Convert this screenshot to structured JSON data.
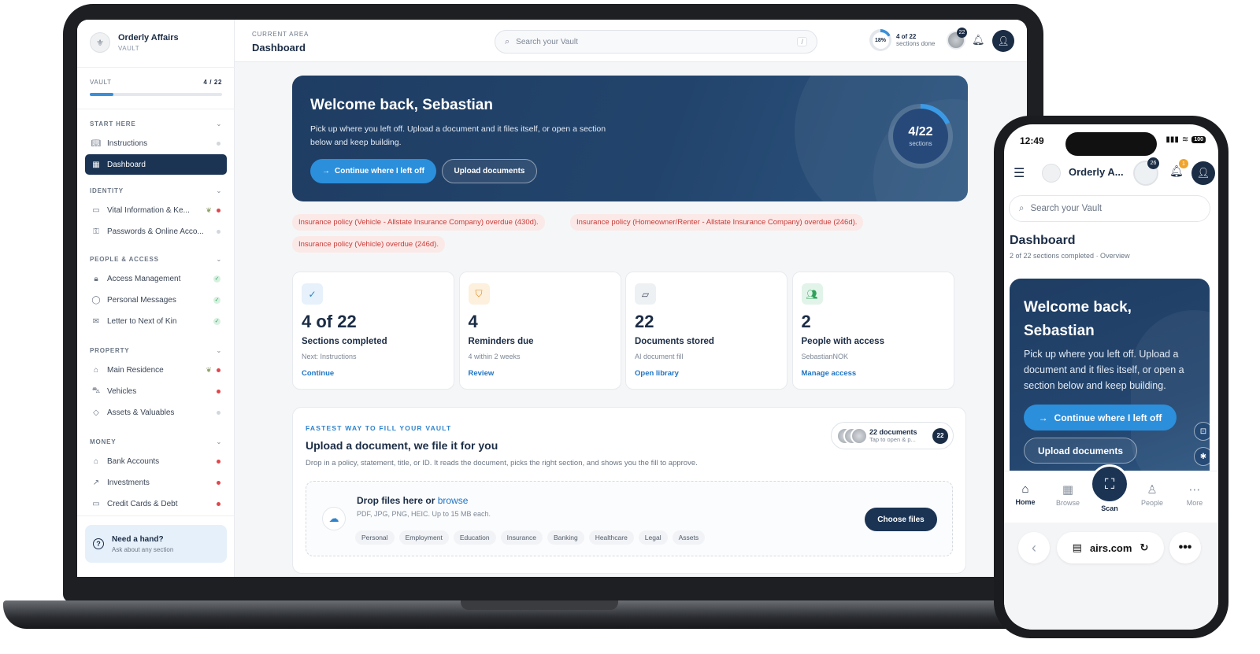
{
  "desktop": {
    "brand": {
      "name": "Orderly Affairs",
      "sub": "VAULT"
    },
    "vault": {
      "label": "VAULT",
      "count": "4 / 22",
      "progress": 0.18
    },
    "groups": [
      {
        "label": "START HERE",
        "items": [
          {
            "label": "Instructions",
            "icon": "book-icon",
            "status": "none"
          },
          {
            "label": "Dashboard",
            "icon": "grid-icon",
            "status": "active"
          }
        ]
      },
      {
        "label": "IDENTITY",
        "items": [
          {
            "label": "Vital Information & Ke...",
            "icon": "id-card-icon",
            "status": "required"
          },
          {
            "label": "Passwords & Online Acco...",
            "icon": "key-icon",
            "status": "none"
          }
        ]
      },
      {
        "label": "PEOPLE & ACCESS",
        "items": [
          {
            "label": "Access Management",
            "icon": "lock-icon",
            "status": "done"
          },
          {
            "label": "Personal Messages",
            "icon": "message-icon",
            "status": "done"
          },
          {
            "label": "Letter to Next of Kin",
            "icon": "mail-icon",
            "status": "done"
          }
        ]
      },
      {
        "label": "PROPERTY",
        "items": [
          {
            "label": "Main Residence",
            "icon": "home-icon",
            "status": "required"
          },
          {
            "label": "Vehicles",
            "icon": "car-icon",
            "status": "required"
          },
          {
            "label": "Assets & Valuables",
            "icon": "gem-icon",
            "status": "none"
          }
        ]
      },
      {
        "label": "MONEY",
        "items": [
          {
            "label": "Bank Accounts",
            "icon": "bank-icon",
            "status": "required"
          },
          {
            "label": "Investments",
            "icon": "trend-icon",
            "status": "required"
          },
          {
            "label": "Credit Cards & Debt",
            "icon": "card-icon",
            "status": "required"
          }
        ]
      }
    ],
    "help": {
      "title": "Need a hand?",
      "sub": "Ask about any section"
    },
    "topbar": {
      "area_label": "CURRENT AREA",
      "area_title": "Dashboard",
      "search_placeholder": "Search your Vault",
      "search_kbd": "/",
      "progress_pct": "18%",
      "progress_main": "4 of 22",
      "progress_sub": "sections done",
      "docs_badge": "22"
    },
    "hero": {
      "title": "Welcome back, Sebastian",
      "text": "Pick up where you left off. Upload a document and it files itself, or open a section below and keep building.",
      "primary": "Continue where I left off",
      "secondary": "Upload documents",
      "ring_value": "4/22",
      "ring_label": "sections",
      "ring_progress": 0.18
    },
    "alerts": [
      "Insurance policy (Vehicle - Allstate Insurance Company) overdue (430d).",
      "Insurance policy (Homeowner/Renter - Allstate Insurance Company) overdue (246d).",
      "Insurance policy (Vehicle) overdue (246d)."
    ],
    "cards": [
      {
        "value": "4 of 22",
        "label": "Sections completed",
        "sub": "Next: Instructions",
        "link": "Continue",
        "icon": "check-circle-icon",
        "color": "#2f83cc",
        "bg": "#e6f1fb"
      },
      {
        "value": "4",
        "label": "Reminders due",
        "sub": "4 within 2 weeks",
        "link": "Review",
        "icon": "shield-icon",
        "color": "#e08a1e",
        "bg": "#fdf0dc"
      },
      {
        "value": "22",
        "label": "Documents stored",
        "sub": "AI document fill",
        "link": "Open library",
        "icon": "folder-icon",
        "color": "#3b4656",
        "bg": "#eef1f4"
      },
      {
        "value": "2",
        "label": "People with access",
        "sub": "SebastianNOK",
        "link": "Manage access",
        "icon": "people-icon",
        "color": "#2fa25a",
        "bg": "#e2f4e9"
      }
    ],
    "upload": {
      "kicker": "FASTEST WAY TO FILL YOUR VAULT",
      "title": "Upload a document, we file it for you",
      "sub": "Drop in a policy, statement, title, or ID. It reads the document, picks the right section, and shows you the fill to approve.",
      "docs_main": "22 documents",
      "docs_sub": "Tap to open & p...",
      "docs_count": "22",
      "drop_title": "Drop files here or",
      "drop_browse": "browse",
      "drop_sub": "PDF, JPG, PNG, HEIC. Up to 15 MB each.",
      "tags": [
        "Personal",
        "Employment",
        "Education",
        "Insurance",
        "Banking",
        "Healthcare",
        "Legal",
        "Assets"
      ],
      "choose": "Choose files"
    }
  },
  "phone": {
    "time": "12:49",
    "battery": "100",
    "brand": "Orderly A...",
    "docs_badge": "26",
    "bell_badge": "1",
    "search_placeholder": "Search your Vault",
    "title": "Dashboard",
    "sub": "2 of 22 sections completed · Overview",
    "hero_title": "Welcome back, Sebastian",
    "hero_text": "Pick up where you left off. Upload a document and it files itself, or open a section below and keep building.",
    "primary": "Continue where I left off",
    "secondary": "Upload documents",
    "nav": {
      "home": "Home",
      "browse": "Browse",
      "scan": "Scan",
      "people": "People",
      "more": "More"
    },
    "url": "airs.com"
  }
}
